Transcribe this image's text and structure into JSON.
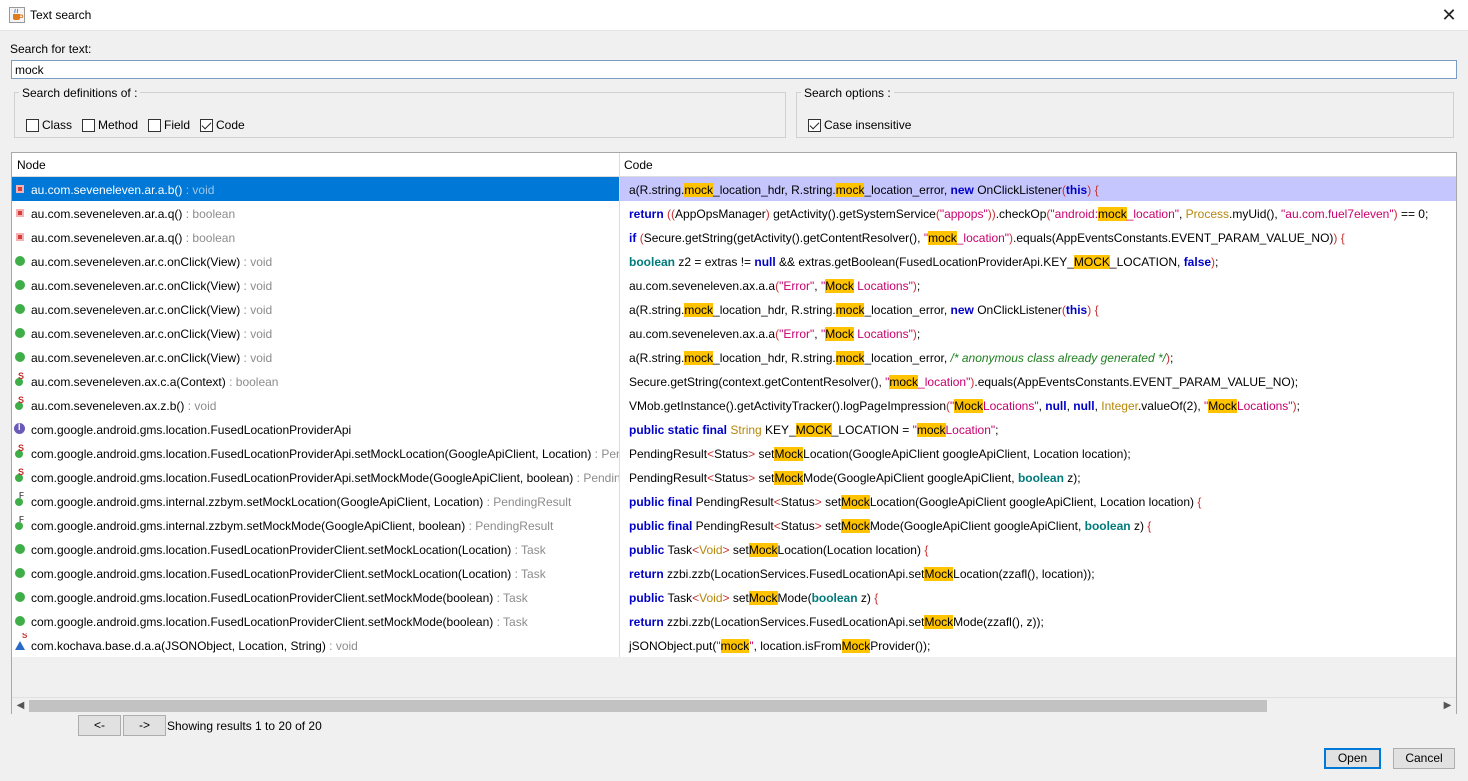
{
  "window": {
    "title": "Text search",
    "app_icon": "java-cup-icon",
    "close_icon": "close-icon"
  },
  "search": {
    "label": "Search for text:",
    "value": "mock"
  },
  "definitions": {
    "title": "Search definitions of :",
    "options": [
      {
        "label": "Class",
        "checked": false
      },
      {
        "label": "Method",
        "checked": false
      },
      {
        "label": "Field",
        "checked": false
      },
      {
        "label": "Code",
        "checked": true
      }
    ]
  },
  "search_options": {
    "title": "Search options :",
    "options": [
      {
        "label": "Case insensitive",
        "checked": true
      }
    ]
  },
  "table": {
    "headers": {
      "node": "Node",
      "code": "Code"
    },
    "rows": [
      {
        "node": "au.com.seveneleven.ar.a.b()",
        "ret": " : void",
        "icon": "private-method-icon",
        "selected": true,
        "code": [
          [
            "",
            "a(R.string."
          ],
          [
            "hl",
            "mock"
          ],
          [
            "",
            "_location_hdr, R.string."
          ],
          [
            "hl",
            "mock"
          ],
          [
            "",
            "_location_error, "
          ],
          [
            "kw",
            "new"
          ],
          [
            "",
            " OnClickListener"
          ],
          [
            "br",
            "("
          ],
          [
            "kw",
            "this"
          ],
          [
            "br",
            ") {"
          ]
        ]
      },
      {
        "node": "au.com.seveneleven.ar.a.q()",
        "ret": " : boolean",
        "icon": "private-method-icon",
        "code": [
          [
            "kw",
            "return"
          ],
          [
            "",
            " "
          ],
          [
            "br",
            "(("
          ],
          [
            "",
            "AppOpsManager"
          ],
          [
            "br",
            ")"
          ],
          [
            "",
            " getActivity().getSystemService"
          ],
          [
            "br",
            "("
          ],
          [
            "str",
            "\"appops\""
          ],
          [
            "br",
            "))"
          ],
          [
            "",
            ".checkOp"
          ],
          [
            "br",
            "("
          ],
          [
            "str",
            "\"android:"
          ],
          [
            "hl",
            "mock"
          ],
          [
            "str",
            "_location\""
          ],
          [
            "",
            ", "
          ],
          [
            "typ",
            "Process"
          ],
          [
            "",
            ".myUid(), "
          ],
          [
            "str",
            "\"au.com.fuel7eleven\""
          ],
          [
            "br",
            ")"
          ],
          [
            "",
            " == 0;"
          ]
        ]
      },
      {
        "node": "au.com.seveneleven.ar.a.q()",
        "ret": " : boolean",
        "icon": "private-method-icon",
        "code": [
          [
            "kw",
            "if"
          ],
          [
            "",
            " "
          ],
          [
            "br",
            "("
          ],
          [
            "",
            "Secure.getString(getActivity().getContentResolver(), "
          ],
          [
            "str",
            "\""
          ],
          [
            "hl",
            "mock"
          ],
          [
            "str",
            "_location\""
          ],
          [
            "br",
            ")"
          ],
          [
            "",
            ".equals(AppEventsConstants.EVENT_PARAM_VALUE_NO)"
          ],
          [
            "br",
            ") {"
          ]
        ]
      },
      {
        "node": "au.com.seveneleven.ar.c.onClick(View)",
        "ret": " : void",
        "icon": "public-method-icon",
        "code": [
          [
            "kt",
            "boolean"
          ],
          [
            "",
            " z2 = extras != "
          ],
          [
            "kw",
            "null"
          ],
          [
            "",
            " && extras.getBoolean(FusedLocationProviderApi.KEY_"
          ],
          [
            "hl",
            "MOCK"
          ],
          [
            "",
            "_LOCATION, "
          ],
          [
            "kw",
            "false"
          ],
          [
            "br",
            ")"
          ],
          [
            "",
            ";"
          ]
        ]
      },
      {
        "node": "au.com.seveneleven.ar.c.onClick(View)",
        "ret": " : void",
        "icon": "public-method-icon",
        "code": [
          [
            "",
            "au.com.seveneleven.ax.a.a"
          ],
          [
            "br",
            "("
          ],
          [
            "str",
            "\"Error\""
          ],
          [
            "",
            ", "
          ],
          [
            "str",
            "\""
          ],
          [
            "hl",
            "Mock"
          ],
          [
            "str",
            " Locations\""
          ],
          [
            "br",
            ")"
          ],
          [
            "",
            ";"
          ]
        ]
      },
      {
        "node": "au.com.seveneleven.ar.c.onClick(View)",
        "ret": " : void",
        "icon": "public-method-icon",
        "code": [
          [
            "",
            "a(R.string."
          ],
          [
            "hl",
            "mock"
          ],
          [
            "",
            "_location_hdr, R.string."
          ],
          [
            "hl",
            "mock"
          ],
          [
            "",
            "_location_error, "
          ],
          [
            "kw",
            "new"
          ],
          [
            "",
            "",
            " OnClickListener"
          ],
          [
            "br",
            "("
          ],
          [
            "kw",
            "this"
          ],
          [
            "br",
            ") {"
          ]
        ]
      },
      {
        "node": "au.com.seveneleven.ar.c.onClick(View)",
        "ret": " : void",
        "icon": "public-method-icon",
        "code": [
          [
            "",
            "au.com.seveneleven.ax.a.a"
          ],
          [
            "br",
            "("
          ],
          [
            "str",
            "\"Error\""
          ],
          [
            "",
            ", "
          ],
          [
            "str",
            "\""
          ],
          [
            "hl",
            "Mock"
          ],
          [
            "str",
            " Locations\""
          ],
          [
            "br",
            ")"
          ],
          [
            "",
            ";"
          ]
        ]
      },
      {
        "node": "au.com.seveneleven.ar.c.onClick(View)",
        "ret": " : void",
        "icon": "public-method-icon",
        "code": [
          [
            "",
            "a(R.string."
          ],
          [
            "hl",
            "mock"
          ],
          [
            "",
            "_location_hdr, R.string."
          ],
          [
            "hl",
            "mock"
          ],
          [
            "",
            "_location_error, "
          ],
          [
            "com",
            "/* anonymous class already generated */"
          ],
          [
            "br",
            ")"
          ],
          [
            "",
            ";"
          ]
        ]
      },
      {
        "node": "au.com.seveneleven.ax.c.a(Context)",
        "ret": " : boolean",
        "icon": "static-method-icon",
        "code": [
          [
            "",
            "Secure.getString(context.getContentResolver(), "
          ],
          [
            "str",
            "\""
          ],
          [
            "hl",
            "mock"
          ],
          [
            "str",
            "_location\""
          ],
          [
            "br",
            ")"
          ],
          [
            "",
            ".equals(AppEventsConstants.EVENT_PARAM_VALUE_NO);"
          ]
        ]
      },
      {
        "node": "au.com.seveneleven.ax.z.b()",
        "ret": " : void",
        "icon": "static-method-icon",
        "code": [
          [
            "",
            "VMob.getInstance().getActivityTracker().logPageImpression"
          ],
          [
            "br",
            "("
          ],
          [
            "str",
            "\""
          ],
          [
            "hl",
            "Mock"
          ],
          [
            "str",
            "Locations\""
          ],
          [
            "",
            ", "
          ],
          [
            "kw",
            "null"
          ],
          [
            "",
            ", "
          ],
          [
            "kw",
            "null"
          ],
          [
            "",
            ", "
          ],
          [
            "typ",
            "Integer"
          ],
          [
            "",
            ".valueOf(2), "
          ],
          [
            "str",
            "\""
          ],
          [
            "hl",
            "Mock"
          ],
          [
            "str",
            "Locations\""
          ],
          [
            "br",
            ")"
          ],
          [
            "",
            ";"
          ]
        ]
      },
      {
        "node": "com.google.android.gms.location.FusedLocationProviderApi",
        "ret": "",
        "icon": "interface-icon",
        "code": [
          [
            "kw",
            "public static final"
          ],
          [
            "",
            " "
          ],
          [
            "typ",
            "String"
          ],
          [
            "",
            " KEY_"
          ],
          [
            "hl",
            "MOCK"
          ],
          [
            "",
            "_LOCATION = "
          ],
          [
            "str",
            "\""
          ],
          [
            "hl",
            "mock"
          ],
          [
            "str",
            "Location\""
          ],
          [
            "",
            ";"
          ]
        ]
      },
      {
        "node": "com.google.android.gms.location.FusedLocationProviderApi.setMockLocation(GoogleApiClient, Location)",
        "ret": " : PendingResult",
        "icon": "abstract-method-icon",
        "code": [
          [
            "",
            "PendingResult"
          ],
          [
            "br",
            "<"
          ],
          [
            "",
            "Status"
          ],
          [
            "br",
            ">"
          ],
          [
            "",
            " set"
          ],
          [
            "hl",
            "Mock"
          ],
          [
            "",
            "Location(GoogleApiClient googleApiClient, Location location);"
          ]
        ]
      },
      {
        "node": "com.google.android.gms.location.FusedLocationProviderApi.setMockMode(GoogleApiClient, boolean)",
        "ret": " : PendingResult",
        "icon": "abstract-method-icon",
        "code": [
          [
            "",
            "PendingResult"
          ],
          [
            "br",
            "<"
          ],
          [
            "",
            "Status"
          ],
          [
            "br",
            ">"
          ],
          [
            "",
            " set"
          ],
          [
            "hl",
            "Mock"
          ],
          [
            "",
            "Mode(GoogleApiClient googleApiClient, "
          ],
          [
            "kt",
            "boolean"
          ],
          [
            "",
            " z);"
          ]
        ]
      },
      {
        "node": "com.google.android.gms.internal.zzbym.setMockLocation(GoogleApiClient, Location)",
        "ret": " : PendingResult",
        "icon": "final-method-icon",
        "code": [
          [
            "kw",
            "public final"
          ],
          [
            "",
            " PendingResult"
          ],
          [
            "br",
            "<"
          ],
          [
            "",
            "Status"
          ],
          [
            "br",
            ">"
          ],
          [
            "",
            " set"
          ],
          [
            "hl",
            "Mock"
          ],
          [
            "",
            "Location(GoogleApiClient googleApiClient, Location location) "
          ],
          [
            "br",
            "{"
          ]
        ]
      },
      {
        "node": "com.google.android.gms.internal.zzbym.setMockMode(GoogleApiClient, boolean)",
        "ret": " : PendingResult",
        "icon": "final-method-icon",
        "code": [
          [
            "kw",
            "public final"
          ],
          [
            "",
            " PendingResult"
          ],
          [
            "br",
            "<"
          ],
          [
            "",
            "Status"
          ],
          [
            "br",
            ">"
          ],
          [
            "",
            " set"
          ],
          [
            "hl",
            "Mock"
          ],
          [
            "",
            "Mode(GoogleApiClient googleApiClient, "
          ],
          [
            "kt",
            "boolean"
          ],
          [
            "",
            " z) "
          ],
          [
            "br",
            "{"
          ]
        ]
      },
      {
        "node": "com.google.android.gms.location.FusedLocationProviderClient.setMockLocation(Location)",
        "ret": " : Task",
        "icon": "public-method-icon",
        "code": [
          [
            "kw",
            "public"
          ],
          [
            "",
            " Task"
          ],
          [
            "br",
            "<"
          ],
          [
            "typ",
            "Void"
          ],
          [
            "br",
            ">"
          ],
          [
            "",
            " set"
          ],
          [
            "hl",
            "Mock"
          ],
          [
            "",
            "Location(Location location) "
          ],
          [
            "br",
            "{"
          ]
        ]
      },
      {
        "node": "com.google.android.gms.location.FusedLocationProviderClient.setMockLocation(Location)",
        "ret": " : Task",
        "icon": "public-method-icon",
        "code": [
          [
            "kw",
            "return"
          ],
          [
            "",
            " zzbi.zzb(LocationServices.FusedLocationApi.set"
          ],
          [
            "hl",
            "Mock"
          ],
          [
            "",
            "Location(zzafl(), location));"
          ]
        ]
      },
      {
        "node": "com.google.android.gms.location.FusedLocationProviderClient.setMockMode(boolean)",
        "ret": " : Task",
        "icon": "public-method-icon",
        "code": [
          [
            "kw",
            "public"
          ],
          [
            "",
            " Task"
          ],
          [
            "br",
            "<"
          ],
          [
            "typ",
            "Void"
          ],
          [
            "br",
            ">"
          ],
          [
            "",
            " set"
          ],
          [
            "hl",
            "Mock"
          ],
          [
            "",
            "Mode("
          ],
          [
            "kt",
            "boolean"
          ],
          [
            "",
            " z) "
          ],
          [
            "br",
            "{"
          ]
        ]
      },
      {
        "node": "com.google.android.gms.location.FusedLocationProviderClient.setMockMode(boolean)",
        "ret": " : Task",
        "icon": "public-method-icon",
        "code": [
          [
            "kw",
            "return"
          ],
          [
            "",
            " zzbi.zzb(LocationServices.FusedLocationApi.set"
          ],
          [
            "hl",
            "Mock"
          ],
          [
            "",
            "Mode(zzafl(), z));"
          ]
        ]
      },
      {
        "node": "com.kochava.base.d.a.a(JSONObject, Location, String)",
        "ret": " : void",
        "icon": "package-static-method-icon",
        "code": [
          [
            "",
            "jSONObject.put("
          ],
          [
            "str",
            "\""
          ],
          [
            "hl",
            "mock"
          ],
          [
            "str",
            "\""
          ],
          [
            "",
            ", location.isFrom"
          ],
          [
            "hl",
            "Mock"
          ],
          [
            "",
            "Provider());"
          ]
        ]
      }
    ]
  },
  "pager": {
    "prev": "<-",
    "next": "->",
    "status": "Showing results 1 to 20 of 20"
  },
  "buttons": {
    "open": "Open",
    "cancel": "Cancel"
  }
}
